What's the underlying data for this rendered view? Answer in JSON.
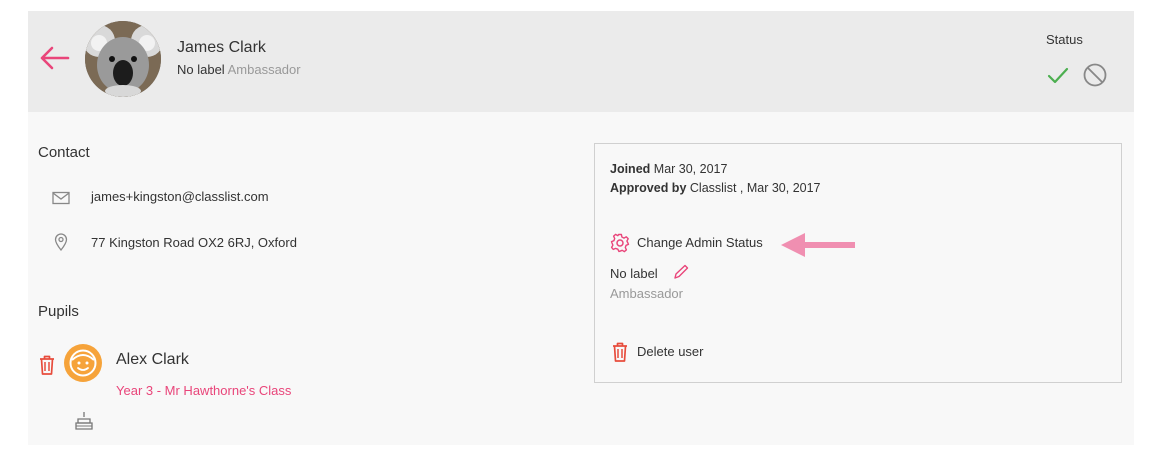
{
  "header": {
    "name": "James Clark",
    "label": "No label",
    "role": "Ambassador",
    "status_title": "Status"
  },
  "contact": {
    "title": "Contact",
    "email": "james+kingston@classlist.com",
    "address": "77 Kingston Road OX2 6RJ, Oxford"
  },
  "details": {
    "joined_label": "Joined",
    "joined_date": "Mar 30, 2017",
    "approved_label": "Approved by",
    "approved_value": "Classlist , Mar 30, 2017",
    "change_admin": "Change Admin Status",
    "label": "No label",
    "role": "Ambassador",
    "delete": "Delete user"
  },
  "pupils": {
    "title": "Pupils",
    "items": [
      {
        "name": "Alex Clark",
        "class": "Year 3 - Mr Hawthorne's Class"
      }
    ]
  },
  "colors": {
    "accent_pink": "#e9457a",
    "arrow_pink": "#f08fb1",
    "delete_red": "#e74c3c",
    "check_green": "#4caf50",
    "pupil_avatar": "#f6a33a"
  },
  "icons": {
    "back": "arrow-left-icon",
    "approve": "check-icon",
    "block": "block-icon",
    "email": "envelope-icon",
    "address": "location-pin-icon",
    "settings": "gear-icon",
    "edit": "pencil-icon",
    "delete": "trash-icon",
    "birthday": "cake-icon"
  }
}
